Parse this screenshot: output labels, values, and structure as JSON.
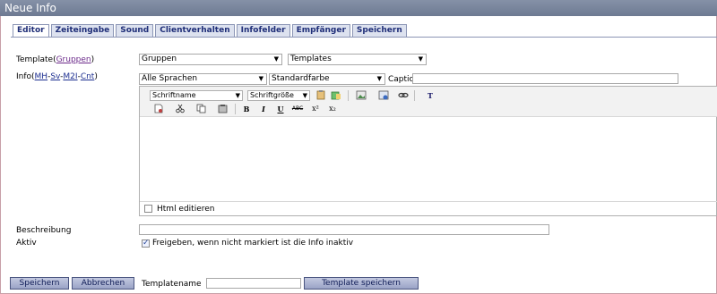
{
  "window": {
    "title": "Neue Info"
  },
  "tabs": [
    {
      "label": "Editor",
      "active": true
    },
    {
      "label": "Zeiteingabe",
      "active": false
    },
    {
      "label": "Sound",
      "active": false
    },
    {
      "label": "Clientverhalten",
      "active": false
    },
    {
      "label": "Infofelder",
      "active": false
    },
    {
      "label": "Empfänger",
      "active": false
    },
    {
      "label": "Speichern",
      "active": false
    }
  ],
  "template": {
    "label_prefix": "Template(",
    "link": "Gruppen",
    "label_suffix": ")",
    "group_select": "Gruppen",
    "template_select": "Templates"
  },
  "info": {
    "label_prefix": "Info(",
    "links": [
      "MH",
      "Sv",
      "M2I",
      "Cnt"
    ],
    "separator": "-",
    "label_suffix": ")",
    "language_select": "Alle Sprachen",
    "color_select": "Standardfarbe",
    "caption_label": "Caption",
    "caption_value": ""
  },
  "editor": {
    "font_name": "Schriftname",
    "font_size": "Schriftgröße",
    "html_edit_label": "Html editieren",
    "html_edit_checked": false,
    "toolbar_text": {
      "bold": "B",
      "italic": "I",
      "underline": "U",
      "strike": "ABC",
      "superscript": "x²",
      "subscript": "x₂",
      "styles": "T"
    }
  },
  "description": {
    "label": "Beschreibung",
    "value": ""
  },
  "active": {
    "label": "Aktiv",
    "checkbox_label": "Freigeben, wenn nicht markiert ist die Info inaktiv",
    "checked": true
  },
  "footer": {
    "save": "Speichern",
    "cancel": "Abbrechen",
    "template_name_label": "Templatename",
    "template_name_value": "",
    "save_template": "Template speichern"
  },
  "colors": {
    "titlebar": "#7a859c",
    "tab_text": "#1f2e78",
    "button_bg": "#aab2d0"
  }
}
